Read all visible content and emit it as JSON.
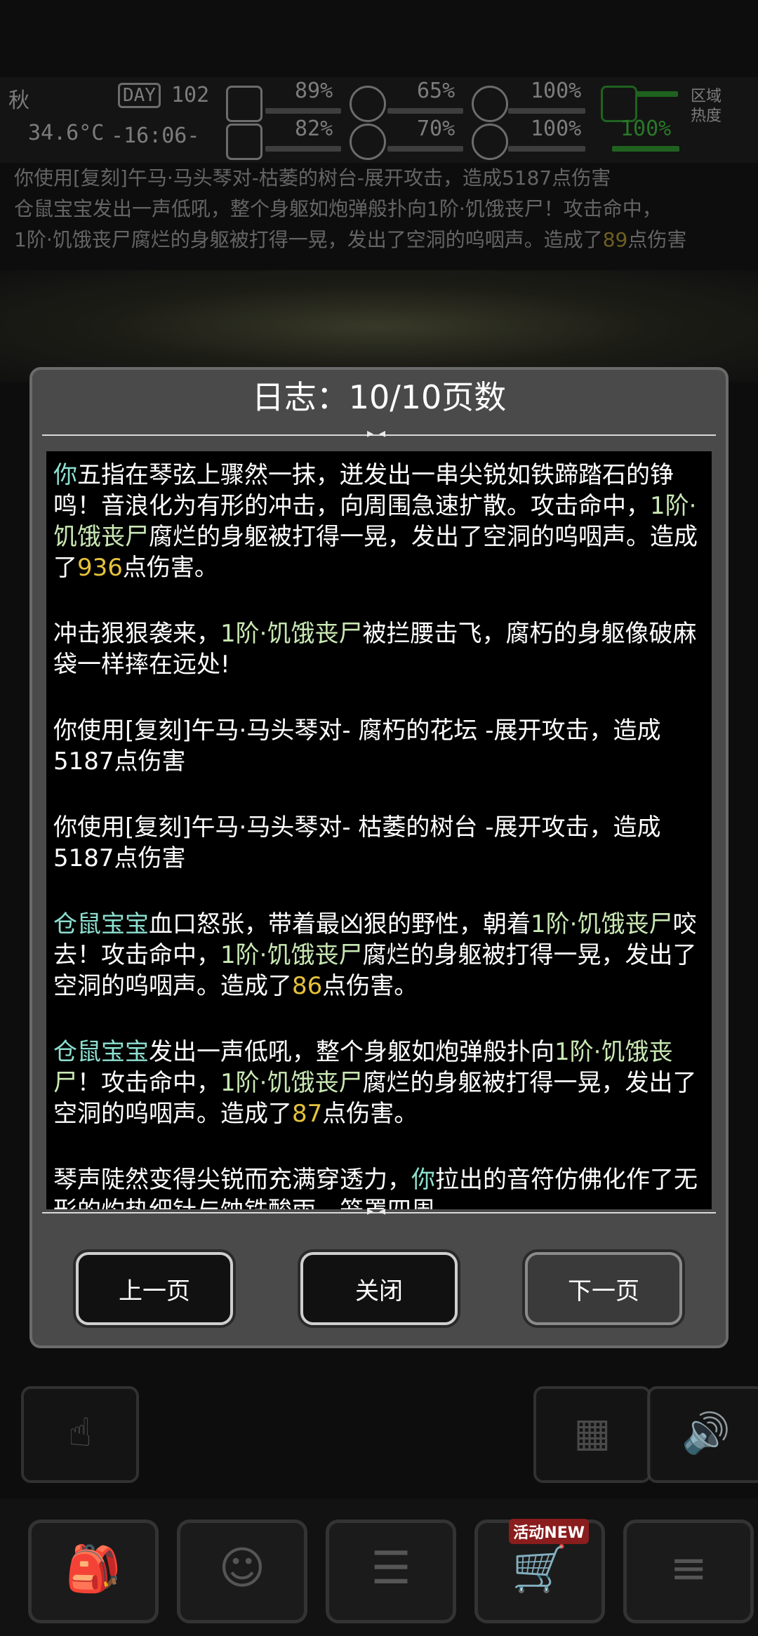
{
  "hud": {
    "season": "秋",
    "day_label": "DAY",
    "day_value": "102",
    "temperature": "34.6°C",
    "time": "-16:06-",
    "stats_top": [
      "89%",
      "65%",
      "100%"
    ],
    "stats_bottom": [
      "82%",
      "70%",
      "100%",
      "100%"
    ],
    "region_label": "区域热度"
  },
  "background_log": {
    "line1_a": "你使用[复刻]午马·马头琴对-",
    "line1_b": "枯萎的树台",
    "line1_c": "-展开攻击，造成5187点伤害",
    "line2_a": "仓鼠宝宝",
    "line2_b": "发出一声低吼，整个身躯如炮弹般扑向",
    "line2_c": "1阶·饥饿丧尸",
    "line2_d": "！攻击命中，",
    "line3_a": "1阶·饥饿丧尸",
    "line3_b": "腐烂的身躯被打得一晃，发出了空洞的呜咽声。造成了",
    "line3_c": "89",
    "line3_d": "点伤害"
  },
  "modal": {
    "title": "日志：10/10页数",
    "entries": [
      {
        "p1": "你",
        "p2": "五指在琴弦上骤然一抹，迸发出一串尖锐如铁蹄踏石的铮鸣！音浪化为有形的冲击，向周围急速扩散。攻击命中，",
        "p3": "1阶·饥饿丧尸",
        "p4": "腐烂的身躯被打得一晃，发出了空洞的呜咽声。造成了",
        "p5": "936",
        "p6": "点伤害。"
      },
      {
        "p1": "冲击狠狠袭来，",
        "p2": "1阶·饥饿丧尸",
        "p3": "被拦腰击飞，腐朽的身躯像破麻袋一样摔在远处!"
      },
      {
        "text": "你使用[复刻]午马·马头琴对- 腐朽的花坛 -展开攻击，造成5187点伤害"
      },
      {
        "text": "你使用[复刻]午马·马头琴对- 枯萎的树台 -展开攻击，造成5187点伤害"
      },
      {
        "p1": "仓鼠宝宝",
        "p2": "血口怒张，带着最凶狠的野性，朝着",
        "p3": "1阶·饥饿丧尸",
        "p4": "咬去！攻击命中，",
        "p5": "1阶·饥饿丧尸",
        "p6": "腐烂的身躯被打得一晃，发出了空洞的呜咽声。造成了",
        "p7": "86",
        "p8": "点伤害。"
      },
      {
        "p1": "仓鼠宝宝",
        "p2": "发出一声低吼，整个身躯如炮弹般扑向",
        "p3": "1阶·饥饿丧尸",
        "p4": "！攻击命中，",
        "p5": "1阶·饥饿丧尸",
        "p6": "腐烂的身躯被打得一晃，发出了空洞的呜咽声。造成了",
        "p7": "87",
        "p8": "点伤害。"
      },
      {
        "p1": "琴声陡然变得尖锐而充满穿透力，",
        "p2": "你",
        "p3": "拉出的音符仿佛化作了无形的灼热细针与蚀铁酸雨，笼罩四周。"
      }
    ],
    "buttons": {
      "prev": "上一页",
      "close": "关闭",
      "next": "下一页"
    }
  },
  "bottom_nav": {
    "items": [
      "backpack-icon",
      "brain-icon",
      "notebook-icon",
      "cart-icon",
      "list-icon"
    ],
    "badge": "活动NEW"
  },
  "colors": {
    "player": "#8ce0d0",
    "enemy": "#c9e8b4",
    "damage": "#e6c23a"
  }
}
